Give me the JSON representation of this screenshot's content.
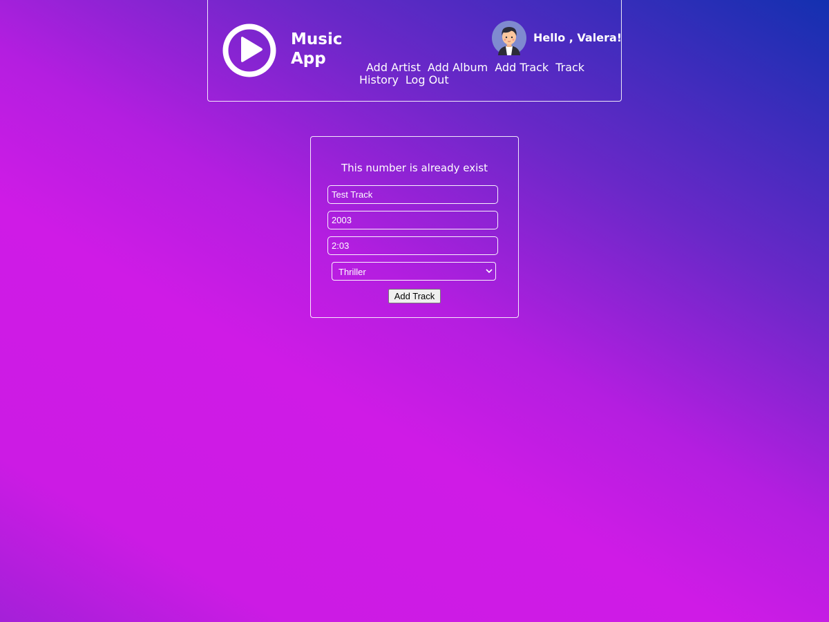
{
  "header": {
    "app_title": "Music App",
    "logo_icon": "play-circle-icon",
    "greeting": "Hello , Valera!",
    "avatar_icon": "user-avatar-icon",
    "nav": {
      "add_artist": "Add Artist",
      "add_album": "Add Album",
      "add_track": "Add Track",
      "track_history_1": "Track",
      "track_history_2": "History",
      "log_out": "Log Out"
    }
  },
  "form": {
    "error_message": "This number is already exist",
    "title_value": "Test Track",
    "number_value": "2003",
    "duration_value": "2:03",
    "album_selected": "Thriller",
    "submit_label": "Add Track"
  },
  "colors": {
    "gradient_top_right": "#1330b0",
    "gradient_main": "#cf1be6",
    "text": "#ffffff"
  }
}
